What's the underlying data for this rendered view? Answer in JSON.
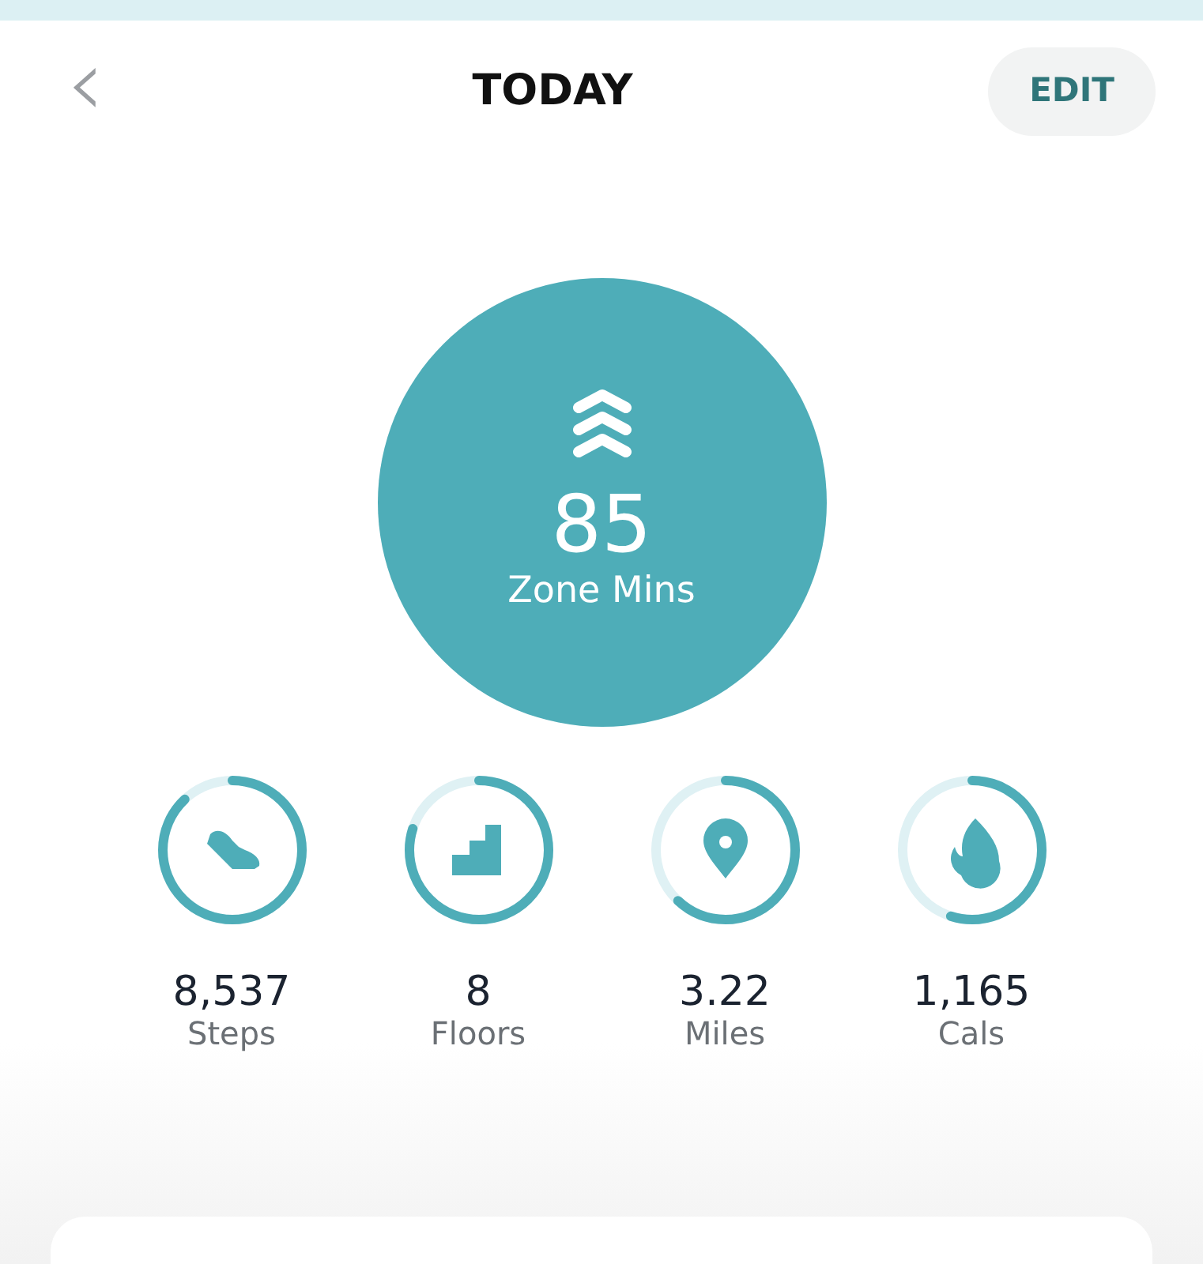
{
  "header": {
    "back": "‹",
    "title": "TODAY",
    "edit_button": "EDIT"
  },
  "zone": {
    "value": "85",
    "label": "Zone Mins"
  },
  "stats": [
    {
      "kind": "steps",
      "value": "8,537",
      "label": "Steps",
      "level": 0.88
    },
    {
      "kind": "floors",
      "value": "8",
      "label": "Floors",
      "level": 0.8
    },
    {
      "kind": "miles",
      "value": "3.22",
      "label": "Miles",
      "level": 0.62
    },
    {
      "kind": "cals",
      "value": "1,165",
      "label": "Cals",
      "level": 0.55
    }
  ]
}
